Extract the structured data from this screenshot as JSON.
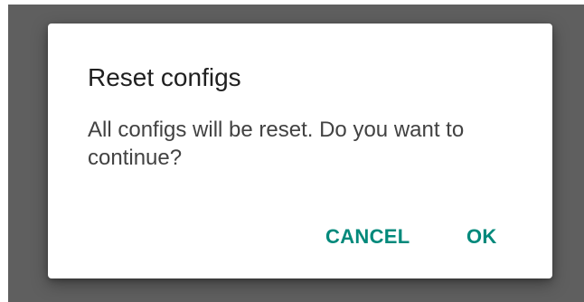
{
  "dialog": {
    "title": "Reset configs",
    "message": "All configs will be reset. Do you want to continue?",
    "cancel_label": "CANCEL",
    "ok_label": "OK"
  },
  "colors": {
    "scrim": "#5f5f5f",
    "dialog_background": "#ffffff",
    "accent": "#00897b",
    "title_text": "#202020",
    "body_text": "#424242"
  }
}
